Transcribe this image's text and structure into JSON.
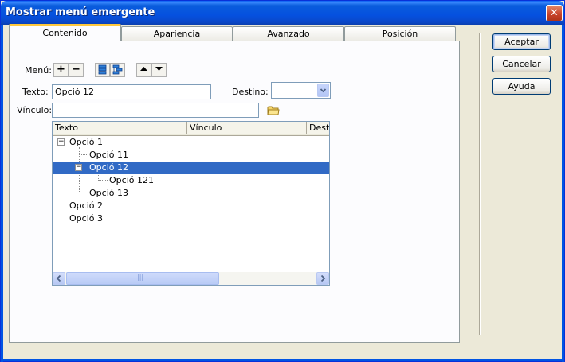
{
  "window": {
    "title": "Mostrar menú emergente",
    "close_glyph": "✕"
  },
  "tabs": [
    {
      "label": "Contenido",
      "active": true
    },
    {
      "label": "Apariencia",
      "active": false
    },
    {
      "label": "Avanzado",
      "active": false
    },
    {
      "label": "Posición",
      "active": false
    }
  ],
  "menu_toolbar": {
    "label": "Menú:",
    "add_glyph": "+",
    "remove_glyph": "−",
    "icons": [
      "outdent-icon",
      "indent-icon",
      "move-up-icon",
      "move-down-icon"
    ]
  },
  "fields": {
    "texto_label": "Texto:",
    "texto_value": "Opció 12",
    "destino_label": "Destino:",
    "destino_value": "",
    "vinculo_label": "Vínculo:",
    "vinculo_value": ""
  },
  "tree": {
    "columns": [
      "Texto",
      "Vínculo",
      "Desti"
    ],
    "rows": [
      {
        "text": "Opció 1",
        "expander": "−",
        "selected": false
      },
      {
        "text": "Opció 11",
        "expander": "",
        "selected": false
      },
      {
        "text": "Opció 12",
        "expander": "−",
        "selected": true
      },
      {
        "text": "Opció 121",
        "expander": "",
        "selected": false
      },
      {
        "text": "Opció 13",
        "expander": "",
        "selected": false
      },
      {
        "text": "Opció 2",
        "expander": "",
        "selected": false
      },
      {
        "text": "Opció 3",
        "expander": "",
        "selected": false
      }
    ],
    "scroll_grip": "|||"
  },
  "buttons": {
    "ok": "Aceptar",
    "cancel": "Cancelar",
    "help": "Ayuda"
  },
  "colors": {
    "selection": "#316ac5",
    "titlebar": "#0054e3",
    "active_tab_accent": "#ffc83c"
  }
}
